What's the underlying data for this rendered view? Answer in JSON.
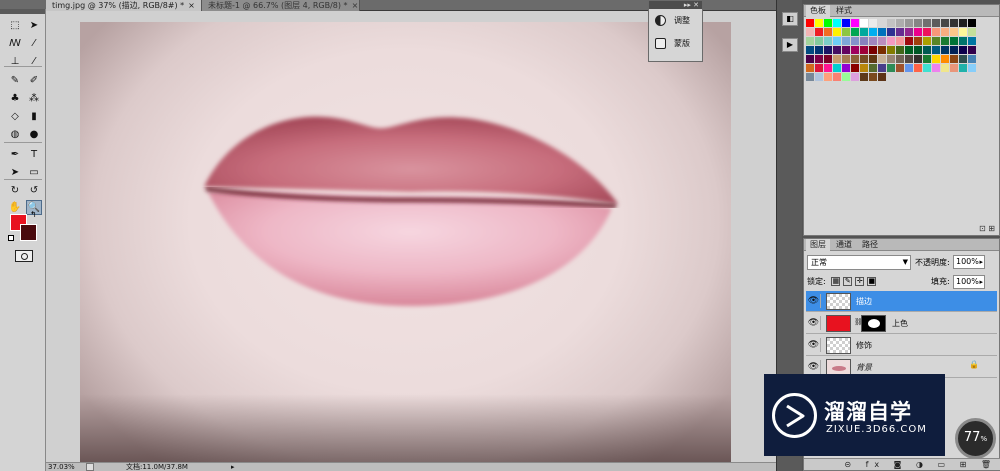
{
  "tabs": [
    {
      "label": "timg.jpg @ 37% (描边, RGB/8#) *",
      "close": "×"
    },
    {
      "label": "未标题-1 @ 66.7% (图层 4, RGB/8) *",
      "close": "×"
    }
  ],
  "tools": [
    {
      "name": "move-tool",
      "glyph": "⬚"
    },
    {
      "name": "marquee-tool",
      "glyph": "➤"
    },
    {
      "name": "lasso-tool",
      "glyph": "ꟿ"
    },
    {
      "name": "quick-select-tool",
      "glyph": "⁄"
    },
    {
      "name": "crop-tool",
      "glyph": "⊥"
    },
    {
      "name": "eyedropper-tool",
      "glyph": "⁄"
    },
    {
      "name": "healing-tool",
      "glyph": "✎"
    },
    {
      "name": "brush-tool",
      "glyph": "✐"
    },
    {
      "name": "stamp-tool",
      "glyph": "♣"
    },
    {
      "name": "history-brush-tool",
      "glyph": "⁂"
    },
    {
      "name": "eraser-tool",
      "glyph": "◇"
    },
    {
      "name": "gradient-tool",
      "glyph": "▮"
    },
    {
      "name": "blur-tool",
      "glyph": "◍"
    },
    {
      "name": "dodge-tool",
      "glyph": "●"
    },
    {
      "name": "pen-tool",
      "glyph": "✒"
    },
    {
      "name": "type-tool",
      "glyph": "T"
    },
    {
      "name": "path-select-tool",
      "glyph": "➤"
    },
    {
      "name": "shape-tool",
      "glyph": "▭"
    },
    {
      "name": "3d-rotate-tool",
      "glyph": "↻"
    },
    {
      "name": "3d-orbit-tool",
      "glyph": "↺"
    },
    {
      "name": "hand-tool",
      "glyph": "✋"
    },
    {
      "name": "zoom-tool",
      "glyph": "🔍"
    }
  ],
  "colors": {
    "foreground": "#e8121f",
    "background": "#4a0a0e",
    "accent_select": "#3d8ee6",
    "watermark_bg": "#0f1d3d"
  },
  "mini_panel": {
    "collapse": "▸▸ ✕",
    "items": [
      "调整",
      "蒙版"
    ]
  },
  "status": {
    "zoom": "37.03%",
    "doc": "文档:11.0M/37.8M"
  },
  "swatch_panel": {
    "tabs": [
      "色板",
      "样式"
    ],
    "foot": "⊡ ⊞"
  },
  "swatch_colors": [
    "#ff0000",
    "#ffff00",
    "#00ff00",
    "#00ffff",
    "#0000ff",
    "#ff00ff",
    "#ffffff",
    "#ebebeb",
    "#d6d6d6",
    "#c2c2c2",
    "#adadad",
    "#999999",
    "#858585",
    "#707070",
    "#5c5c5c",
    "#474747",
    "#333333",
    "#1f1f1f",
    "#000000",
    "#f2b4b4",
    "#ee1d24",
    "#f26c23",
    "#fff200",
    "#8dc63f",
    "#00a651",
    "#00a99d",
    "#00aeef",
    "#0072bc",
    "#2e3192",
    "#662d91",
    "#92278f",
    "#ec008c",
    "#ed145b",
    "#f7977a",
    "#f9ad81",
    "#fdc68a",
    "#fff79a",
    "#c4df9b",
    "#a3d39c",
    "#82ca9d",
    "#7bcdc8",
    "#6ecff6",
    "#7ea7d8",
    "#8493ca",
    "#8882be",
    "#a186be",
    "#bc8dbf",
    "#f49ac2",
    "#f6989d",
    "#9e0b0f",
    "#a0410d",
    "#aba000",
    "#598527",
    "#1a7b30",
    "#007236",
    "#00746b",
    "#0076a3",
    "#004a80",
    "#003471",
    "#1b1464",
    "#440e62",
    "#630460",
    "#9e005d",
    "#9e0039",
    "#790000",
    "#7b2e00",
    "#827b00",
    "#406618",
    "#005e20",
    "#005826",
    "#005952",
    "#005b7f",
    "#003663",
    "#002157",
    "#0d004c",
    "#32004b",
    "#4b0049",
    "#7b0046",
    "#7a0026",
    "#c69c6d",
    "#a67c52",
    "#8c6239",
    "#754c24",
    "#603913",
    "#c7b299",
    "#998675",
    "#736357",
    "#534741",
    "#362f2d",
    "#197b30",
    "#ffd700",
    "#ff8c00",
    "#8b4513",
    "#2f4f4f",
    "#4682b4",
    "#d2691e",
    "#dc143c",
    "#ff1493",
    "#00ced1",
    "#9400d3",
    "#8b0000",
    "#b8860b",
    "#556b2f",
    "#483d8b",
    "#2e8b57",
    "#a0522d",
    "#6495ed",
    "#ff6347",
    "#40e0d0",
    "#ee82ee",
    "#f0e68c",
    "#e9967a",
    "#20b2aa",
    "#87cefa",
    "#778899",
    "#b0c4de",
    "#ffa07a",
    "#fa8072",
    "#98fb98",
    "#dda0dd",
    "#5d3a1a",
    "#7a4a1e",
    "#5c3317"
  ],
  "layers_panel": {
    "tabs": [
      "图层",
      "通道",
      "路径"
    ],
    "blend_mode": "正常",
    "opacity_label": "不透明度:",
    "opacity": "100%",
    "lock_label": "锁定:",
    "fill_label": "填充:",
    "fill": "100%",
    "layers": [
      {
        "name": "描边",
        "selected": true,
        "thumb": "transparent",
        "mask": false,
        "locked": false
      },
      {
        "name": "上色",
        "selected": false,
        "thumb": "#e8121f",
        "mask": true,
        "locked": false
      },
      {
        "name": "修饰",
        "selected": false,
        "thumb": "transparent",
        "mask": false,
        "locked": false
      },
      {
        "name": "背景",
        "selected": false,
        "thumb": "photo",
        "mask": false,
        "locked": true
      }
    ],
    "footer_icons": "⊝ fx ◙ ◑ ▭ ⊞ 🗑"
  },
  "watermark": {
    "title": "溜溜自学",
    "url": "ZIXUE.3D66.COM"
  },
  "zoom_badge": "77"
}
